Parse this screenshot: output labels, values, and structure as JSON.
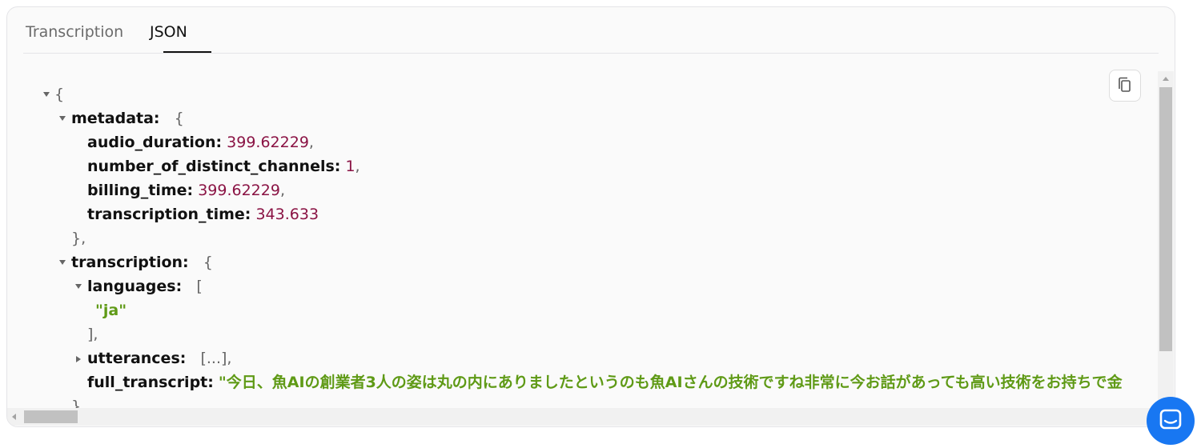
{
  "tabs": [
    {
      "label": "Transcription"
    },
    {
      "label": "JSON"
    }
  ],
  "json_view": {
    "metadata_key": "metadata:",
    "audio_duration_key": "audio_duration:",
    "audio_duration": "399.62229",
    "channels_key": "number_of_distinct_channels:",
    "channels": "1",
    "billing_time_key": "billing_time:",
    "billing_time": "399.62229",
    "transcription_time_key": "transcription_time:",
    "transcription_time": "343.633",
    "transcription_key": "transcription:",
    "languages_key": "languages:",
    "language_value": "\"ja\"",
    "utterances_key": "utterances:",
    "utterances_collapsed": "[...],",
    "full_transcript_key": "full_transcript:",
    "full_transcript": "\"今日、魚AIの創業者3人の姿は丸の内にありましたというのも魚AIさんの技術ですね非常に今お話があっても高い技術をお持ちで金"
  },
  "icons": {
    "copy": "copy-icon",
    "chat": "chat-icon"
  },
  "colors": {
    "key": "#111111",
    "number": "#8a1344",
    "string": "#5f9a16",
    "chat_button": "#1877f2"
  }
}
